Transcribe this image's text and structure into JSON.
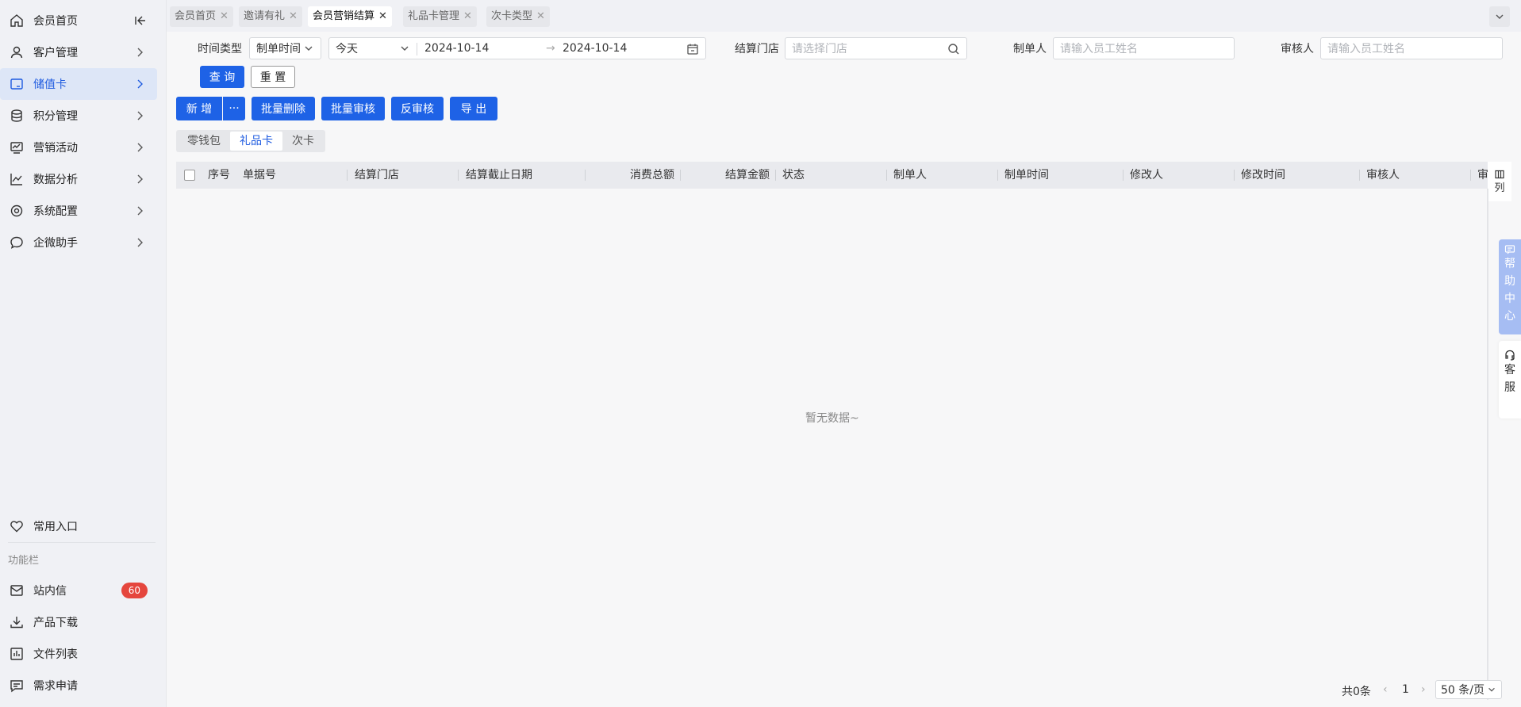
{
  "sidebar": {
    "items": [
      {
        "label": "会员首页"
      },
      {
        "label": "客户管理"
      },
      {
        "label": "储值卡"
      },
      {
        "label": "积分管理"
      },
      {
        "label": "营销活动"
      },
      {
        "label": "数据分析"
      },
      {
        "label": "系统配置"
      },
      {
        "label": "企微助手"
      }
    ],
    "favorites": "常用入口",
    "section_title": "功能栏",
    "bottom": [
      {
        "label": "站内信",
        "badge": "60"
      },
      {
        "label": "产品下载"
      },
      {
        "label": "文件列表"
      },
      {
        "label": "需求申请"
      }
    ]
  },
  "tabs": [
    {
      "label": "会员首页"
    },
    {
      "label": "邀请有礼"
    },
    {
      "label": "会员营销结算"
    },
    {
      "label": "礼品卡管理"
    },
    {
      "label": "次卡类型"
    }
  ],
  "filters": {
    "time_type_label": "时间类型",
    "time_type_value": "制单时间",
    "range_value": "今天",
    "date_start": "2024-10-14",
    "date_end": "2024-10-14",
    "store_label": "结算门店",
    "store_placeholder": "请选择门店",
    "maker_label": "制单人",
    "maker_placeholder": "请输入员工姓名",
    "reviewer_label": "审核人",
    "reviewer_placeholder": "请输入员工姓名",
    "query": "查 询",
    "reset": "重 置"
  },
  "actions": {
    "add": "新 增",
    "more": "···",
    "batch_delete": "批量删除",
    "batch_review": "批量审核",
    "unreview": "反审核",
    "export": "导 出"
  },
  "segments": [
    "零钱包",
    "礼品卡",
    "次卡"
  ],
  "table": {
    "columns": [
      "序号",
      "单据号",
      "结算门店",
      "结算截止日期",
      "消费总额",
      "结算金额",
      "状态",
      "制单人",
      "制单时间",
      "修改人",
      "修改时间",
      "审核人",
      "审"
    ],
    "column_toggle": "列",
    "empty": "暂无数据~"
  },
  "pagination": {
    "total": "共0条",
    "page": "1",
    "page_size": "50 条/页"
  },
  "floating": {
    "help": [
      "帮",
      "助",
      "中",
      "心"
    ],
    "service": [
      "客",
      "服"
    ]
  },
  "colors": {
    "primary": "#1e62e6",
    "active_bg": "#dde6f7",
    "badge": "#e5463d"
  }
}
